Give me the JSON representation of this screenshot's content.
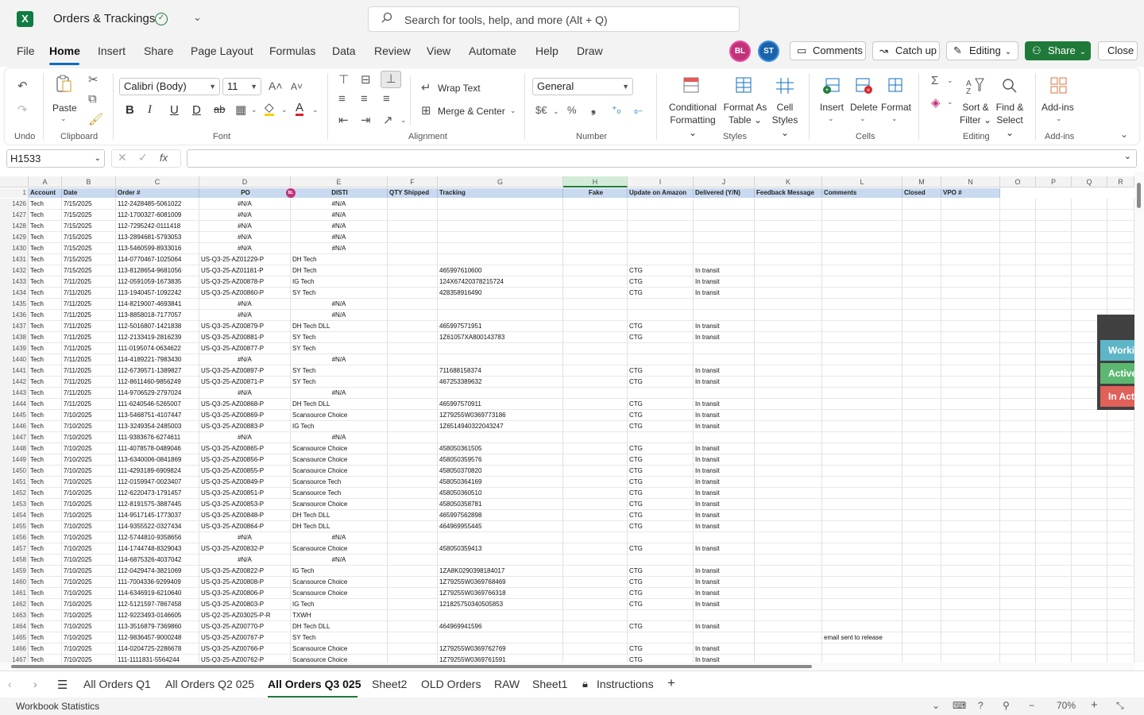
{
  "app": {
    "title": "Orders & Trackings",
    "search_placeholder": "Search for tools, help, and more (Alt + Q)"
  },
  "menu": {
    "tabs": [
      "File",
      "Home",
      "Insert",
      "Share",
      "Page Layout",
      "Formulas",
      "Data",
      "Review",
      "View",
      "Automate",
      "Help",
      "Draw"
    ]
  },
  "toolbar": {
    "avatar1": "BL",
    "avatar2": "ST",
    "comments": "Comments",
    "catchup": "Catch up",
    "editing": "Editing",
    "share": "Share",
    "close": "Close"
  },
  "ribbon": {
    "undo_label": "Undo",
    "paste": "Paste",
    "clipboard": "Clipboard",
    "font_name": "Calibri (Body)",
    "font_size": "11",
    "font": "Font",
    "wrap_text": "Wrap Text",
    "merge_center": "Merge & Center",
    "alignment": "Alignment",
    "number_format": "General",
    "number": "Number",
    "cond_fmt_1": "Conditional",
    "cond_fmt_2": "Formatting",
    "fmt_table_1": "Format As",
    "fmt_table_2": "Table",
    "cell_styles_1": "Cell",
    "cell_styles_2": "Styles",
    "styles": "Styles",
    "insert": "Insert",
    "delete": "Delete",
    "format": "Format",
    "cells": "Cells",
    "sort_1": "Sort &",
    "sort_2": "Filter",
    "find_1": "Find &",
    "find_2": "Select",
    "editing": "Editing",
    "addins": "Add-ins",
    "addins_group": "Add-ins"
  },
  "formula": {
    "name_box": "H1533",
    "value": ""
  },
  "grid": {
    "columns": [
      "A",
      "B",
      "C",
      "D",
      "E",
      "F",
      "G",
      "H",
      "I",
      "J",
      "K",
      "L",
      "M",
      "N",
      "O",
      "P",
      "Q",
      "R"
    ],
    "header_row_number": "1",
    "headers": [
      "Account",
      "Date",
      "Order #",
      "PO",
      "DISTI",
      "QTY Shipped",
      "Tracking",
      "Fake",
      "Update on Amazon",
      "Delivered (Y/N)",
      "Feedback Message",
      "Comments",
      "Closed",
      "VPO #"
    ],
    "po_avatar": "BL",
    "rows": [
      [
        "1426",
        "Tech",
        "7/15/2025",
        "112-2428485-5061022",
        "#N/A",
        "#N/A",
        "",
        "",
        "",
        "",
        ""
      ],
      [
        "1427",
        "Tech",
        "7/15/2025",
        "112-1700327-6081009",
        "#N/A",
        "#N/A",
        "",
        "",
        "",
        "",
        ""
      ],
      [
        "1428",
        "Tech",
        "7/15/2025",
        "112-7295242-0111418",
        "#N/A",
        "#N/A",
        "",
        "",
        "",
        "",
        ""
      ],
      [
        "1429",
        "Tech",
        "7/15/2025",
        "113-2894681-5793053",
        "#N/A",
        "#N/A",
        "",
        "",
        "",
        "",
        ""
      ],
      [
        "1430",
        "Tech",
        "7/15/2025",
        "113-5460599-8933016",
        "#N/A",
        "#N/A",
        "",
        "",
        "",
        "",
        ""
      ],
      [
        "1431",
        "Tech",
        "7/15/2025",
        "114-0770467-1025064",
        "US-Q3-25-AZ01229-P",
        "DH Tech",
        "",
        "",
        "",
        "",
        ""
      ],
      [
        "1432",
        "Tech",
        "7/15/2025",
        "113-8128654-9681056",
        "US-Q3-25-AZ01181-P",
        "DH Tech",
        "465997610600",
        "",
        "CTG",
        "In transit",
        ""
      ],
      [
        "1433",
        "Tech",
        "7/11/2025",
        "112-0591059-1673835",
        "US-Q3-25-AZ00878-P",
        "IG Tech",
        "124X67420378215724",
        "",
        "CTG",
        "In transit",
        ""
      ],
      [
        "1434",
        "Tech",
        "7/11/2025",
        "113-1940457-1092242",
        "US-Q3-25-AZ00860-P",
        "SY Tech",
        "428358916490",
        "",
        "CTG",
        "In transit",
        ""
      ],
      [
        "1435",
        "Tech",
        "7/11/2025",
        "114-8219007-4693841",
        "#N/A",
        "#N/A",
        "",
        "",
        "",
        "",
        ""
      ],
      [
        "1436",
        "Tech",
        "7/11/2025",
        "113-8858018-7177057",
        "#N/A",
        "#N/A",
        "",
        "",
        "",
        "",
        ""
      ],
      [
        "1437",
        "Tech",
        "7/11/2025",
        "112-5016807-1421838",
        "US-Q3-25-AZ00879-P",
        "DH Tech DLL",
        "465997571951",
        "",
        "CTG",
        "In transit",
        ""
      ],
      [
        "1438",
        "Tech",
        "7/11/2025",
        "112-2133419-2816239",
        "US-Q3-25-AZ00881-P",
        "SY Tech",
        "1Z61057XA800143783",
        "",
        "CTG",
        "In transit",
        ""
      ],
      [
        "1439",
        "Tech",
        "7/11/2025",
        "111-0195074-0634622",
        "US-Q3-25-AZ00877-P",
        "SY Tech",
        "",
        "",
        "",
        "",
        ""
      ],
      [
        "1440",
        "Tech",
        "7/11/2025",
        "114-4189221-7983430",
        "#N/A",
        "#N/A",
        "",
        "",
        "",
        "",
        ""
      ],
      [
        "1441",
        "Tech",
        "7/11/2025",
        "112-6739571-1389827",
        "US-Q3-25-AZ00897-P",
        "SY Tech",
        "711688158374",
        "",
        "CTG",
        "In transit",
        ""
      ],
      [
        "1442",
        "Tech",
        "7/11/2025",
        "112-8611460-9856249",
        "US-Q3-25-AZ00871-P",
        "SY Tech",
        "467253389632",
        "",
        "CTG",
        "In transit",
        ""
      ],
      [
        "1443",
        "Tech",
        "7/11/2025",
        "114-9706529-2797024",
        "#N/A",
        "#N/A",
        "",
        "",
        "",
        "",
        ""
      ],
      [
        "1444",
        "Tech",
        "7/11/2025",
        "111-6240546-5265007",
        "US-Q3-25-AZ00868-P",
        "DH Tech DLL",
        "465997570911",
        "",
        "CTG",
        "In transit",
        ""
      ],
      [
        "1445",
        "Tech",
        "7/10/2025",
        "113-5468751-4107447",
        "US-Q3-25-AZ00869-P",
        "Scansource Choice",
        "1Z79255W0369773186",
        "",
        "CTG",
        "In transit",
        ""
      ],
      [
        "1446",
        "Tech",
        "7/10/2025",
        "113-3249354-2485003",
        "US-Q3-25-AZ00883-P",
        "IG Tech",
        "1Z6514940322043247",
        "",
        "CTG",
        "In transit",
        ""
      ],
      [
        "1447",
        "Tech",
        "7/10/2025",
        "111-9383676-6274611",
        "#N/A",
        "#N/A",
        "",
        "",
        "",
        "",
        ""
      ],
      [
        "1448",
        "Tech",
        "7/10/2025",
        "111-4078578-0489046",
        "US-Q3-25-AZ00865-P",
        "Scansource Choice",
        "458050361505",
        "",
        "CTG",
        "In transit",
        ""
      ],
      [
        "1449",
        "Tech",
        "7/10/2025",
        "113-6340006-0841869",
        "US-Q3-25-AZ00856-P",
        "Scansource Choice",
        "458050359576",
        "",
        "CTG",
        "In transit",
        ""
      ],
      [
        "1450",
        "Tech",
        "7/10/2025",
        "111-4293189-6909824",
        "US-Q3-25-AZ00855-P",
        "Scansource Choice",
        "458050370820",
        "",
        "CTG",
        "In transit",
        ""
      ],
      [
        "1451",
        "Tech",
        "7/10/2025",
        "112-0159947-0023407",
        "US-Q3-25-AZ00849-P",
        "Scansource Tech",
        "458050364169",
        "",
        "CTG",
        "In transit",
        ""
      ],
      [
        "1452",
        "Tech",
        "7/10/2025",
        "112-6220473-1791457",
        "US-Q3-25-AZ00851-P",
        "Scansource Tech",
        "458050360510",
        "",
        "CTG",
        "In transit",
        ""
      ],
      [
        "1453",
        "Tech",
        "7/10/2025",
        "112-8191575-3887445",
        "US-Q3-25-AZ00853-P",
        "Scansource Choice",
        "458050358781",
        "",
        "CTG",
        "In transit",
        ""
      ],
      [
        "1454",
        "Tech",
        "7/10/2025",
        "114-9517145-1773037",
        "US-Q3-25-AZ00848-P",
        "DH Tech DLL",
        "465997562898",
        "",
        "CTG",
        "In transit",
        ""
      ],
      [
        "1455",
        "Tech",
        "7/10/2025",
        "114-9355522-0327434",
        "US-Q3-25-AZ00864-P",
        "DH Tech DLL",
        "464969955445",
        "",
        "CTG",
        "In transit",
        ""
      ],
      [
        "1456",
        "Tech",
        "7/10/2025",
        "112-5744810-9358656",
        "#N/A",
        "#N/A",
        "",
        "",
        "",
        "",
        ""
      ],
      [
        "1457",
        "Tech",
        "7/10/2025",
        "114-1744748-8329043",
        "US-Q3-25-AZ00832-P",
        "Scansource Choice",
        "458050359413",
        "",
        "CTG",
        "In transit",
        ""
      ],
      [
        "1458",
        "Tech",
        "7/10/2025",
        "114-6875326-4037042",
        "#N/A",
        "#N/A",
        "",
        "",
        "",
        "",
        ""
      ],
      [
        "1459",
        "Tech",
        "7/10/2025",
        "112-0429474-3821069",
        "US-Q3-25-AZ00822-P",
        "IG Tech",
        "1ZA8K0290398184017",
        "",
        "CTG",
        "In transit",
        ""
      ],
      [
        "1460",
        "Tech",
        "7/10/2025",
        "111-7004336-9299409",
        "US-Q3-25-AZ00808-P",
        "Scansource Choice",
        "1Z79255W0369768469",
        "",
        "CTG",
        "In transit",
        ""
      ],
      [
        "1461",
        "Tech",
        "7/10/2025",
        "114-6346919-6210640",
        "US-Q3-25-AZ00806-P",
        "Scansource Choice",
        "1Z79255W0369766318",
        "",
        "CTG",
        "In transit",
        ""
      ],
      [
        "1462",
        "Tech",
        "7/10/2025",
        "112-5121597-7867458",
        "US-Q3-25-AZ00803-P",
        "IG Tech",
        "121825750340505853",
        "",
        "CTG",
        "In transit",
        ""
      ],
      [
        "1463",
        "Tech",
        "7/10/2025",
        "112-9223493-0146605",
        "US-Q2-25-AZ03025-P-R",
        "TXWH",
        "",
        "",
        "",
        "",
        ""
      ],
      [
        "1464",
        "Tech",
        "7/10/2025",
        "113-3516879-7369860",
        "US-Q3-25-AZ00770-P",
        "DH Tech DLL",
        "464969941596",
        "",
        "CTG",
        "In transit",
        ""
      ],
      [
        "1465",
        "Tech",
        "7/10/2025",
        "112-9836457-9000248",
        "US-Q3-25-AZ00767-P",
        "SY Tech",
        "",
        "",
        "",
        "",
        "email sent to release"
      ],
      [
        "1466",
        "Tech",
        "7/10/2025",
        "114-0204725-2286678",
        "US-Q3-25-AZ00766-P",
        "Scansource Choice",
        "1Z79255W0369762769",
        "",
        "CTG",
        "In transit",
        ""
      ],
      [
        "1467",
        "Tech",
        "7/10/2025",
        "111-1111831-5564244",
        "US-Q3-25-AZ00762-P",
        "Scansource Choice",
        "1Z79255W0369761591",
        "",
        "CTG",
        "In transit",
        ""
      ]
    ]
  },
  "side_panel": {
    "working": "Working",
    "active": "Active:",
    "inactive": "In Active",
    "working_color": "#5fb5c8",
    "active_color": "#5cb870",
    "inactive_color": "#e0605a"
  },
  "sheets": {
    "tabs": [
      "All Orders Q1",
      "All Orders Q2 025",
      "All Orders Q3 025",
      "Sheet2",
      "OLD Orders",
      "RAW",
      "Sheet1",
      "Instructions"
    ],
    "active": "All Orders Q3 025"
  },
  "status": {
    "workbook_stats": "Workbook Statistics",
    "zoom": "70%"
  },
  "colors": {
    "accent": "#0f6cbd",
    "excel_green": "#1f7a3a",
    "header_fill": "#c9daf0"
  }
}
